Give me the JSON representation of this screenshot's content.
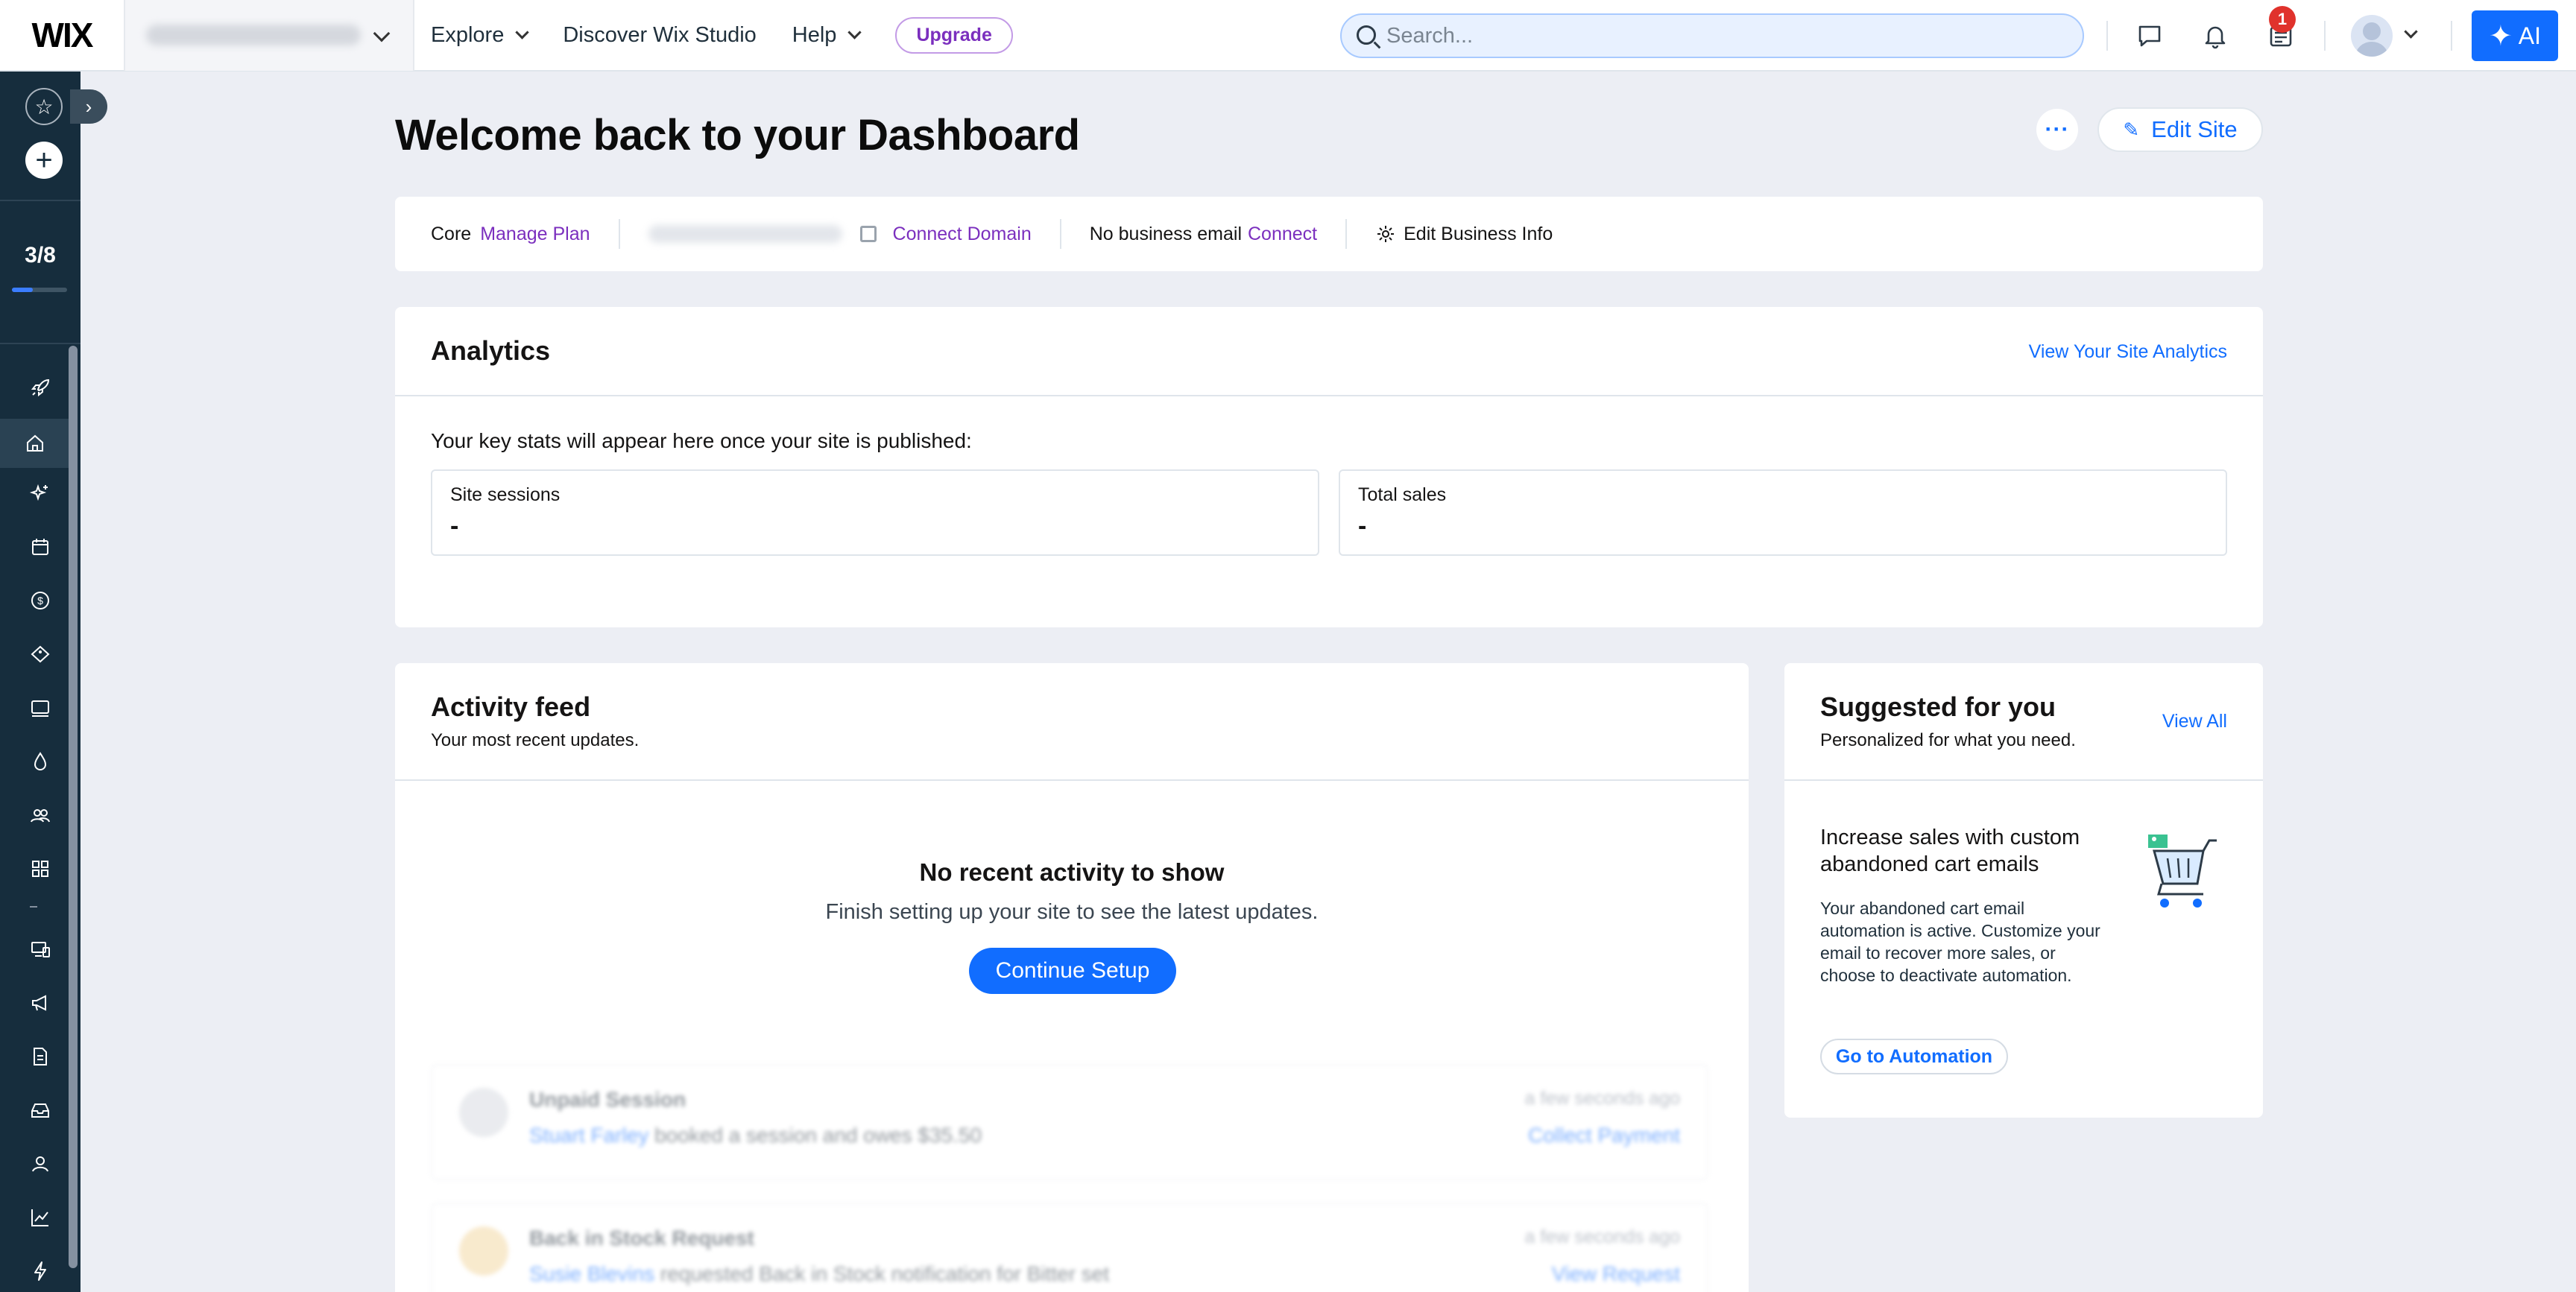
{
  "brand": {
    "logo": "WIX",
    "accent": "#116dff",
    "upgrade_color": "#7b2fbe"
  },
  "topbar": {
    "nav": [
      {
        "label": "Explore",
        "has_dropdown": true
      },
      {
        "label": "Discover Wix Studio",
        "has_dropdown": false
      },
      {
        "label": "Help",
        "has_dropdown": true
      }
    ],
    "upgrade_label": "Upgrade",
    "search_placeholder": "Search...",
    "notification_count": "1",
    "ai_label": "AI",
    "icons": [
      "chat-icon",
      "bell-icon",
      "updates-icon",
      "avatar",
      "sparkle-icon"
    ]
  },
  "sidebar": {
    "setup_progress": "3/8",
    "setup_progress_fraction": 0.375,
    "icons": [
      "rocket-icon",
      "home-icon",
      "sparkle-icon",
      "calendar-icon",
      "dollar-icon",
      "tag-icon",
      "inbox-icon",
      "droplet-icon",
      "people-icon",
      "apps-icon",
      "devices-icon",
      "megaphone-icon",
      "document-icon",
      "tray-icon",
      "contacts-icon",
      "chart-icon",
      "automation-icon"
    ]
  },
  "header": {
    "title": "Welcome back to your Dashboard",
    "more_label": "···",
    "edit_site_label": "Edit Site"
  },
  "info_bar": {
    "plan": "Core",
    "manage_plan": "Manage Plan",
    "connect_domain": "Connect Domain",
    "no_email": "No business email",
    "connect": "Connect",
    "edit_business_info": "Edit Business Info"
  },
  "analytics": {
    "title": "Analytics",
    "view_link": "View Your Site Analytics",
    "intro": "Your key stats will appear here once your site is published:",
    "stats": [
      {
        "label": "Site sessions",
        "value": "-"
      },
      {
        "label": "Total sales",
        "value": "-"
      }
    ]
  },
  "activity": {
    "title": "Activity feed",
    "subtitle": "Your most recent updates.",
    "empty_title": "No recent activity to show",
    "empty_desc": "Finish setting up your site to see the latest updates.",
    "cta": "Continue Setup",
    "sample_items": [
      {
        "title": "Unpaid Session",
        "person": "Stuart Farley",
        "desc": "booked a session and owes $35.50",
        "time": "a few seconds ago",
        "action": "Collect Payment"
      },
      {
        "title": "Back in Stock Request",
        "person": "Susie Blevins",
        "desc": "requested Back in Stock notification for Bitter set",
        "time": "a few seconds ago",
        "action": "View Request"
      }
    ]
  },
  "suggested": {
    "title": "Suggested for you",
    "subtitle": "Personalized for what you need.",
    "view_all": "View All",
    "item_title": "Increase sales with custom abandoned cart emails",
    "item_desc": "Your abandoned cart email automation is active. Customize your email to recover more sales, or choose to deactivate automation.",
    "item_cta": "Go to Automation"
  }
}
